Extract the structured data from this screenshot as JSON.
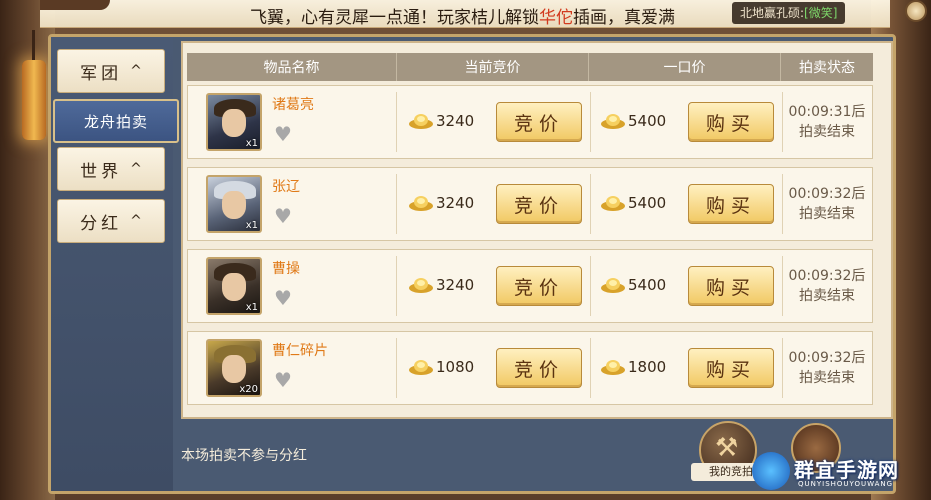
{
  "marquee": {
    "text_a": "飞翼，心有灵犀一点通！玩家桔儿解锁",
    "text_highlight": "华佗",
    "text_b": "插画，真爱满",
    "server_prefix": "北地赢孔硕:",
    "server_status": "[微笑]"
  },
  "sidebar": {
    "items": [
      {
        "label": "军团",
        "chevron": "^"
      },
      {
        "label": "龙舟拍卖",
        "chevron": ""
      },
      {
        "label": "世界",
        "chevron": "^"
      },
      {
        "label": "分红",
        "chevron": "^"
      }
    ]
  },
  "table": {
    "headers": [
      "物品名称",
      "当前竞价",
      "一口价",
      "拍卖状态"
    ],
    "bid_label": "竞价",
    "buy_label": "购买",
    "rows": [
      {
        "name": "诸葛亮",
        "count": "x1",
        "bid": "3240",
        "buyout": "5400",
        "time": "00:09:31后",
        "status": "拍卖结束"
      },
      {
        "name": "张辽",
        "count": "x1",
        "bid": "3240",
        "buyout": "5400",
        "time": "00:09:32后",
        "status": "拍卖结束"
      },
      {
        "name": "曹操",
        "count": "x1",
        "bid": "3240",
        "buyout": "5400",
        "time": "00:09:32后",
        "status": "拍卖结束"
      },
      {
        "name": "曹仁碎片",
        "count": "x20",
        "bid": "1080",
        "buyout": "1800",
        "time": "00:09:32后",
        "status": "拍卖结束"
      }
    ]
  },
  "footer": {
    "note": "本场拍卖不参与分红",
    "my_bid_label": "我的竞拍"
  },
  "watermark": {
    "name": "群宜手游网",
    "sub": "QUNYISHOUYOUWANG"
  },
  "colors": {
    "item_name": "#e07a18",
    "highlight": "#d23a1e",
    "accent_gold": "#f1c862"
  }
}
